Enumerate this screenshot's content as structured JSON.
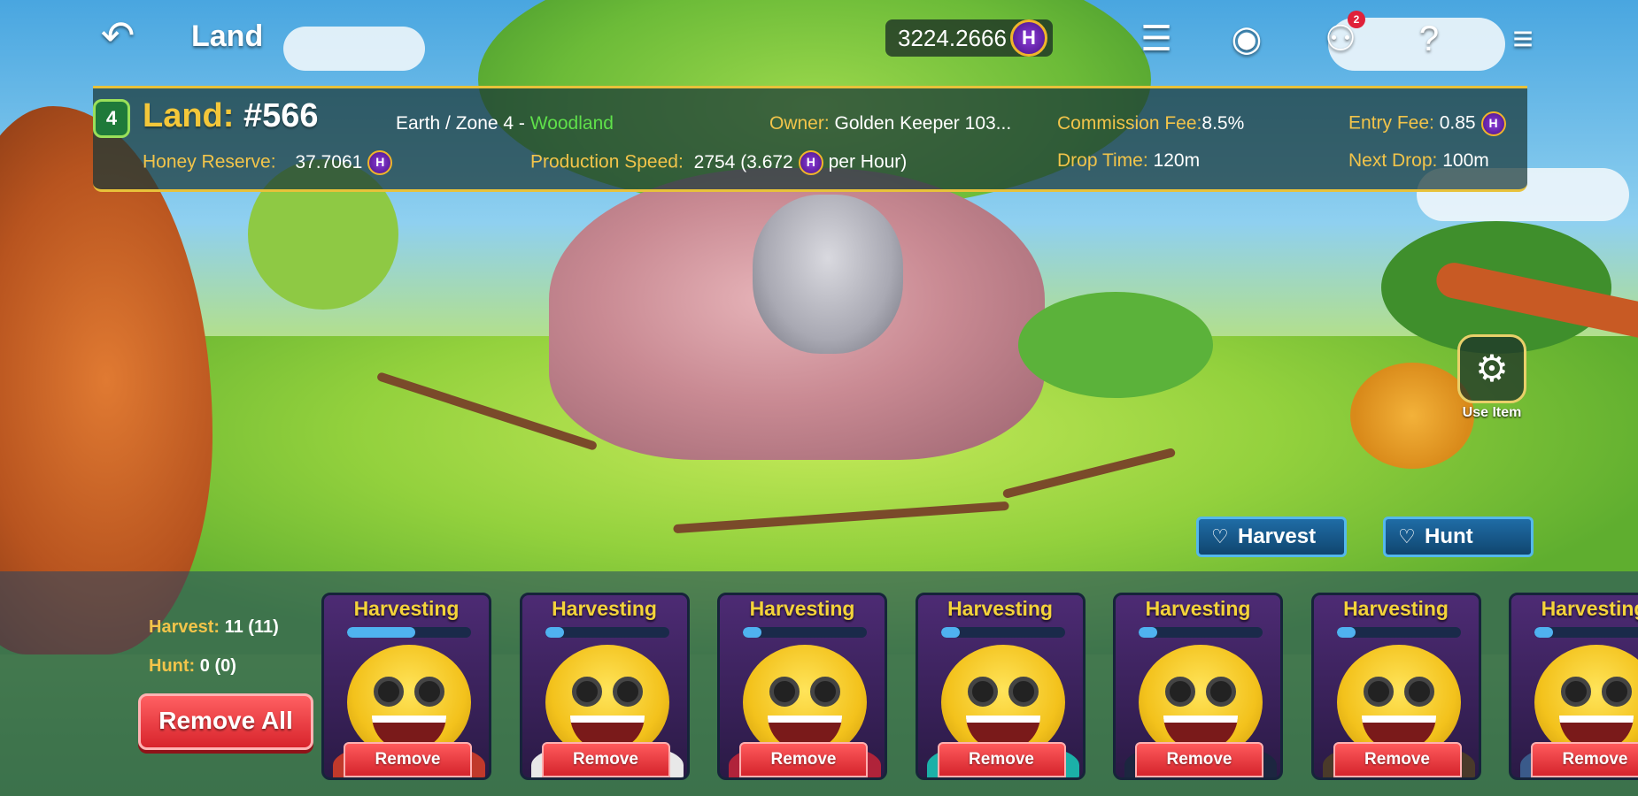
{
  "topbar": {
    "title": "Land",
    "balance": "3224.2666",
    "notification_count": "2"
  },
  "info": {
    "level": "4",
    "land_label": "Land:",
    "land_number": "#566",
    "zone_prefix": "Earth / Zone 4 - ",
    "zone_name": "Woodland",
    "owner_label": "Owner:",
    "owner_value": "Golden Keeper 103...",
    "commission_label": "Commission Fee:",
    "commission_value": "8.5%",
    "entry_label": "Entry Fee:",
    "entry_value": "0.85",
    "honey_label": "Honey Reserve:",
    "honey_value": "37.7061",
    "production_label": "Production Speed:",
    "production_value": "2754 (3.672",
    "production_suffix": "per Hour)",
    "drop_label": "Drop Time:",
    "drop_value": "120m",
    "next_label": "Next Drop:",
    "next_value": "100m"
  },
  "use_item": {
    "label": "Use Item"
  },
  "actions": {
    "harvest": "Harvest",
    "hunt": "Hunt"
  },
  "stats": {
    "harvest_label": "Harvest:",
    "harvest_value": "11 (11)",
    "hunt_label": "Hunt:",
    "hunt_value": "0 (0)"
  },
  "remove_all_label": "Remove All",
  "bees": [
    {
      "status": "Harvesting",
      "remove": "Remove",
      "progress": 0.55,
      "accent": "#c0392b"
    },
    {
      "status": "Harvesting",
      "remove": "Remove",
      "progress": 0.15,
      "accent": "#e8e8e8"
    },
    {
      "status": "Harvesting",
      "remove": "Remove",
      "progress": 0.15,
      "accent": "#b0233a"
    },
    {
      "status": "Harvesting",
      "remove": "Remove",
      "progress": 0.15,
      "accent": "#1bb0a8"
    },
    {
      "status": "Harvesting",
      "remove": "Remove",
      "progress": 0.15,
      "accent": "#1c2640"
    },
    {
      "status": "Harvesting",
      "remove": "Remove",
      "progress": 0.15,
      "accent": "#4a3a2a"
    },
    {
      "status": "Harvesting",
      "remove": "Remove",
      "progress": 0.15,
      "accent": "#3a5a8a"
    }
  ],
  "colors": {
    "gold_label": "#f2c44a",
    "woodland_green": "#5fe04a",
    "remove_red": "#d8242c",
    "action_blue": "#10466f"
  }
}
